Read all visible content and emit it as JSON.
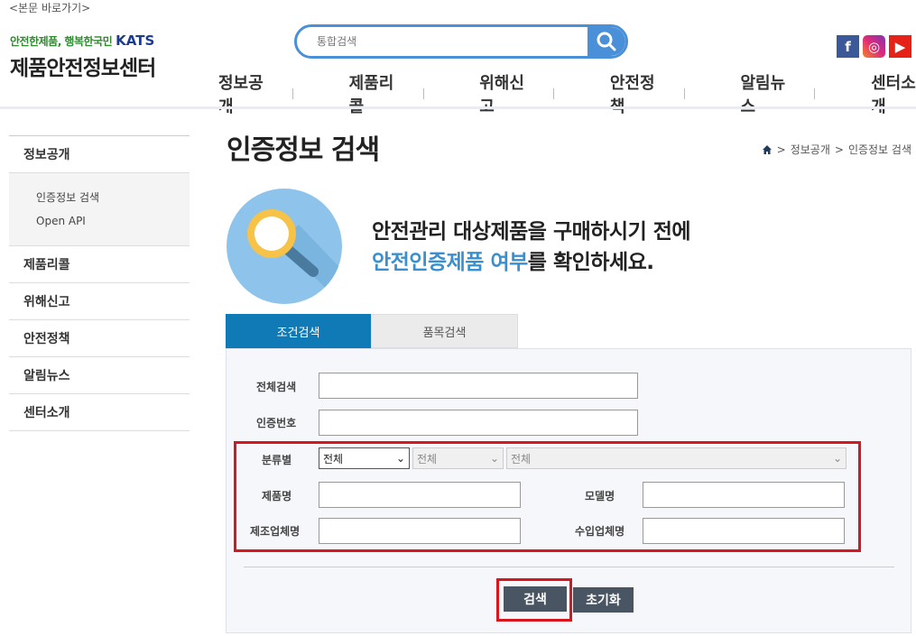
{
  "skip_link": "<본문 바로가기>",
  "logo": {
    "slogan": "안전한제품, 행복한국민",
    "brand": "KATS",
    "name": "제품안전정보센터"
  },
  "search": {
    "placeholder": "통합검색"
  },
  "sns": {
    "facebook": "f",
    "instagram": "◎",
    "youtube": "▶"
  },
  "gnb": [
    "정보공개",
    "제품리콜",
    "위해신고",
    "안전정책",
    "알림뉴스",
    "센터소개"
  ],
  "lnb": {
    "items": [
      "정보공개",
      "제품리콜",
      "위해신고",
      "안전정책",
      "알림뉴스",
      "센터소개"
    ],
    "sub": [
      "인증정보 검색",
      "Open API"
    ]
  },
  "page_title": "인증정보 검색",
  "breadcrumb": {
    "level1": "정보공개",
    "level2": "인증정보 검색"
  },
  "hero": {
    "line1": "안전관리 대상제품을 구매하시기 전에",
    "line2_highlight": "안전인증제품 여부",
    "line2_rest": "를 확인하세요."
  },
  "tabs": [
    "조건검색",
    "품목검색"
  ],
  "form": {
    "all_search": "전체검색",
    "cert_no": "인증번호",
    "category": "분류별",
    "category_options": [
      "전체",
      "전체",
      "전체"
    ],
    "product_name": "제품명",
    "model_name": "모델명",
    "manufacturer": "제조업체명",
    "importer": "수입업체명"
  },
  "buttons": {
    "search": "검색",
    "reset": "초기화"
  },
  "colors": {
    "accent": "#0f7ab5",
    "highlight_red": "#d9161e",
    "hero_blue": "#3a8fcf"
  }
}
